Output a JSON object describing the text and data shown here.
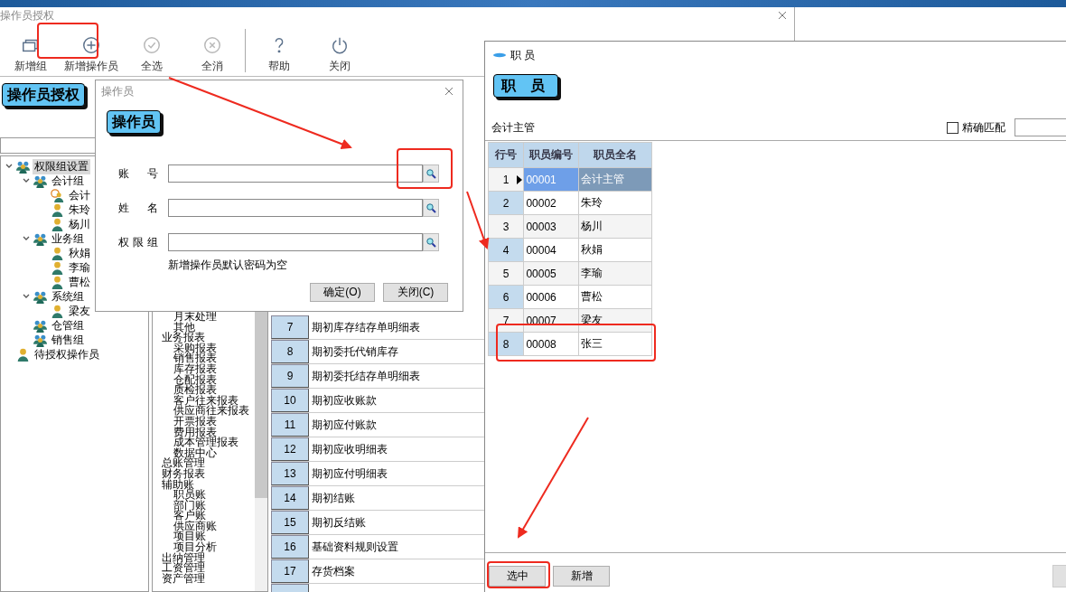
{
  "main_window": {
    "title": "操作员授权",
    "toolbar": {
      "groups": [
        [
          {
            "label": "新增组",
            "kind": "stack",
            "disabled": false
          },
          {
            "label": "新增操作员",
            "kind": "plus",
            "disabled": false
          },
          {
            "label": "全选",
            "kind": "check",
            "disabled": true
          },
          {
            "label": "全消",
            "kind": "cross",
            "disabled": true
          }
        ],
        [
          {
            "label": "帮助",
            "kind": "help",
            "disabled": false
          },
          {
            "label": "关闭",
            "kind": "power",
            "disabled": false
          }
        ]
      ]
    },
    "banner": "操作员授权",
    "tree": [
      {
        "label": "权限组设置",
        "kind": "group",
        "selected": true,
        "expanded": true,
        "children": [
          {
            "label": "会计组",
            "kind": "group",
            "selected": false,
            "expanded": true,
            "children": [
              {
                "label": "会计",
                "kind": "admin",
                "selected": false
              },
              {
                "label": "朱玲",
                "kind": "user",
                "selected": false
              },
              {
                "label": "杨川",
                "kind": "user",
                "selected": false
              }
            ]
          },
          {
            "label": "业务组",
            "kind": "group",
            "selected": false,
            "expanded": true,
            "children": [
              {
                "label": "秋娟",
                "kind": "user",
                "selected": false
              },
              {
                "label": "李瑜",
                "kind": "user",
                "selected": false
              },
              {
                "label": "曹松",
                "kind": "user",
                "selected": false
              }
            ]
          },
          {
            "label": "系统组",
            "kind": "group",
            "selected": false,
            "expanded": true,
            "children": [
              {
                "label": "梁友",
                "kind": "user",
                "selected": false
              }
            ]
          },
          {
            "label": "仓管组",
            "kind": "group",
            "selected": false
          },
          {
            "label": "销售组",
            "kind": "group",
            "selected": false
          }
        ]
      },
      {
        "label": "待授权操作员",
        "kind": "user",
        "selected": false
      }
    ],
    "menu_tree": [
      {
        "children": [
          {
            "label": "月末处理"
          },
          {
            "label": "其他"
          }
        ]
      },
      {
        "label": "业务报表",
        "children": [
          {
            "label": "采购报表"
          },
          {
            "label": "销售报表"
          },
          {
            "label": "库存报表"
          },
          {
            "label": "仓配报表"
          },
          {
            "label": "质检报表"
          },
          {
            "label": "客户往来报表"
          },
          {
            "label": "供应商往来报表"
          },
          {
            "label": "开票报表"
          },
          {
            "label": "费用报表"
          },
          {
            "label": "成本管理报表"
          },
          {
            "label": "数据中心"
          }
        ]
      },
      {
        "label": "总账管理"
      },
      {
        "label": "财务报表"
      },
      {
        "label": "辅助账",
        "children": [
          {
            "label": "职员账"
          },
          {
            "label": "部门账"
          },
          {
            "label": "客户账"
          },
          {
            "label": "供应商账"
          },
          {
            "label": "项目账"
          },
          {
            "label": "项目分析"
          }
        ]
      },
      {
        "label": "出纳管理"
      },
      {
        "label": "工资管理"
      },
      {
        "label": "资产管理"
      }
    ],
    "task_rows": [
      {
        "no": "7",
        "label": "期初库存结存单明细表"
      },
      {
        "no": "8",
        "label": "期初委托代销库存"
      },
      {
        "no": "9",
        "label": "期初委托结存单明细表"
      },
      {
        "no": "10",
        "label": "期初应收账款"
      },
      {
        "no": "11",
        "label": "期初应付账款"
      },
      {
        "no": "12",
        "label": "期初应收明细表"
      },
      {
        "no": "13",
        "label": "期初应付明细表"
      },
      {
        "no": "14",
        "label": "期初结账"
      },
      {
        "no": "15",
        "label": "期初反结账"
      },
      {
        "no": "16",
        "label": "基础资料规则设置"
      },
      {
        "no": "17",
        "label": "存货档案"
      }
    ]
  },
  "operator_dialog": {
    "title": "操作员",
    "banner": "操作员",
    "fields": [
      {
        "label": "账 号"
      },
      {
        "label": "姓 名"
      },
      {
        "label": "权 限 组"
      }
    ],
    "note": "新增操作员默认密码为空",
    "buttons": [
      "确定(O)",
      "关闭(C)"
    ]
  },
  "employee_window": {
    "title": "职 员",
    "banner": "职　员",
    "filter_label": "会计主管",
    "exact_match": {
      "label": "精确匹配",
      "checked": false
    },
    "columns": [
      "行号",
      "职员编号",
      "职员全名"
    ],
    "rows": [
      {
        "no": "1",
        "code": "00001",
        "name": "会计主管",
        "selected": true
      },
      {
        "no": "2",
        "code": "00002",
        "name": "朱玲",
        "selected": false
      },
      {
        "no": "3",
        "code": "00003",
        "name": "杨川",
        "selected": false
      },
      {
        "no": "4",
        "code": "00004",
        "name": "秋娟",
        "selected": false
      },
      {
        "no": "5",
        "code": "00005",
        "name": "李瑜",
        "selected": false
      },
      {
        "no": "6",
        "code": "00006",
        "name": "曹松",
        "selected": false
      },
      {
        "no": "7",
        "code": "00007",
        "name": "梁友",
        "selected": false
      },
      {
        "no": "8",
        "code": "00008",
        "name": "张三",
        "selected": false
      }
    ],
    "buttons": [
      "选中",
      "新增"
    ]
  }
}
